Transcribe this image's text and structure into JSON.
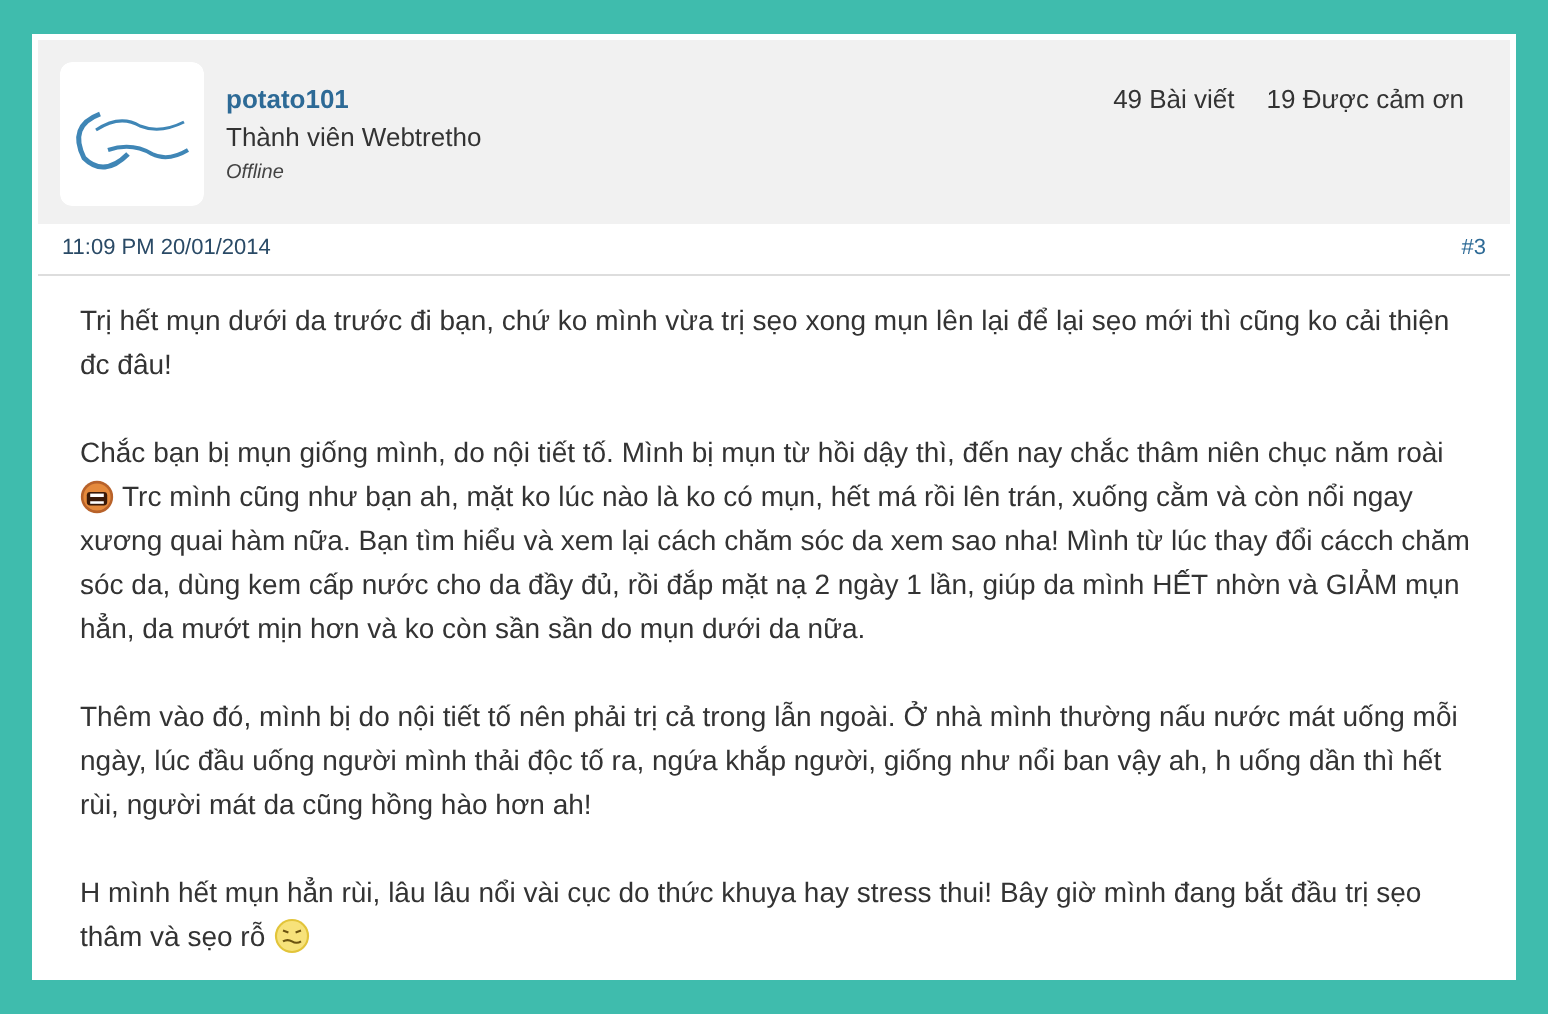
{
  "author": {
    "username": "potato101",
    "rank": "Thành viên Webtretho",
    "status": "Offline"
  },
  "stats": [
    "49 Bài viết",
    "19 Được cảm ơn"
  ],
  "post": {
    "time": "11:09 PM 20/01/2014",
    "number": "#3"
  },
  "paragraphs": [
    {
      "lines": [
        [
          {
            "kind": "text",
            "text": "Trị hết mụn dưới da trước đi bạn, chứ ko mình vừa trị sẹo xong mụn lên lại để lại sẹo mới thì cũng ko cải thiện đc đâu!"
          }
        ]
      ]
    },
    {
      "lines": [
        [
          {
            "kind": "text",
            "text": "Chắc bạn bị mụn giống mình, do nội tiết tố. Mình bị mụn từ hồi dậy thì, đến nay chắc thâm niên chục năm roài"
          }
        ],
        [
          {
            "kind": "shout"
          },
          {
            "kind": "text",
            "text": "Trc mình cũng như bạn ah, mặt ko lúc nào là ko có mụn, hết má rồi lên trán, xuống cằm và còn nổi ngay"
          }
        ],
        [
          {
            "kind": "text",
            "text": "xương quai hàm nữa. Bạn tìm hiểu và xem lại cách chăm sóc da xem sao nha! Mình từ lúc thay đổi cácch chăm sóc da, dùng kem cấp nước cho da đầy đủ, rồi đắp mặt nạ 2 ngày 1 lần, giúp da mình HẾT nhờn và GIẢM mụn hẳn, da mướt mịn hơn và ko còn sần sần do mụn dưới da nữa."
          }
        ]
      ]
    },
    {
      "lines": [
        [
          {
            "kind": "text",
            "text": "Thêm vào đó, mình bị do nội tiết tố nên phải trị cả trong lẫn ngoài. Ở nhà mình thường nấu nước mát uống mỗi ngày, lúc đầu uống người mình thải độc tố ra, ngứa khắp người, giống như nổi ban vậy ah, h uống dần thì hết rùi, người mát da cũng hồng hào hơn ah!"
          }
        ]
      ]
    },
    {
      "lines": [
        [
          {
            "kind": "text",
            "text": "H mình hết mụn hẳn rùi, lâu lâu nổi vài cục do thức khuya hay stress thui! Bây giờ mình đang bắt đầu trị sẹo"
          }
        ],
        [
          {
            "kind": "text",
            "text": "thâm và sẹo rỗ"
          },
          {
            "kind": "worried"
          }
        ]
      ]
    }
  ]
}
